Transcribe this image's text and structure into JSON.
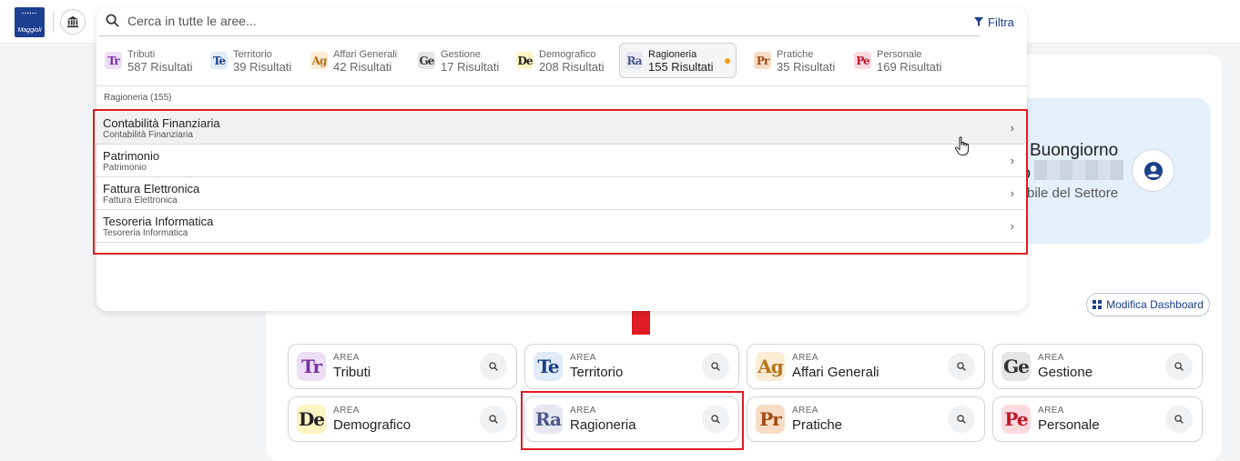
{
  "header": {
    "logo_text": "Maggioli"
  },
  "greeting": {
    "title": "Buongiorno",
    "prefix": "o",
    "role": "bile del Settore"
  },
  "dashboard": {
    "edit_label": "Modifica Dashboard",
    "area_caption": "AREA",
    "areas": [
      {
        "abbr": "Tr",
        "name": "Tributi",
        "color": "#7b2fa6",
        "bg": "#ecdff5"
      },
      {
        "abbr": "Te",
        "name": "Territorio",
        "color": "#1c3f88",
        "bg": "#e1ecf8"
      },
      {
        "abbr": "Ag",
        "name": "Affari Generali",
        "color": "#b8741a",
        "bg": "#fbecd6"
      },
      {
        "abbr": "Ge",
        "name": "Gestione",
        "color": "#333333",
        "bg": "#e5e5e5"
      },
      {
        "abbr": "De",
        "name": "Demografico",
        "color": "#222222",
        "bg": "#fdf4c4"
      },
      {
        "abbr": "Ra",
        "name": "Ragioneria",
        "color": "#4b5689",
        "bg": "#e6e8f1"
      },
      {
        "abbr": "Pr",
        "name": "Pratiche",
        "color": "#a34a15",
        "bg": "#f7dcc6"
      },
      {
        "abbr": "Pe",
        "name": "Personale",
        "color": "#c0162a",
        "bg": "#fadadf"
      }
    ]
  },
  "search": {
    "placeholder": "Cerca in tutte le aree...",
    "filter_label": "Filtra",
    "chips": [
      {
        "abbr": "Tr",
        "name": "Tributi",
        "count": "587 Risultati",
        "color": "#7b2fa6",
        "bg": "#ecdff5"
      },
      {
        "abbr": "Te",
        "name": "Territorio",
        "count": "39 Risultati",
        "color": "#1c3f88",
        "bg": "#e1ecf8"
      },
      {
        "abbr": "Ag",
        "name": "Affari Generali",
        "count": "42 Risultati",
        "color": "#b8741a",
        "bg": "#fbecd6"
      },
      {
        "abbr": "Ge",
        "name": "Gestione",
        "count": "17 Risultati",
        "color": "#333333",
        "bg": "#e5e5e5"
      },
      {
        "abbr": "De",
        "name": "Demografico",
        "count": "208 Risultati",
        "color": "#222222",
        "bg": "#fdf4c4"
      },
      {
        "abbr": "Ra",
        "name": "Ragioneria",
        "count": "155 Risultati",
        "color": "#4b5689",
        "bg": "#e6e8f1"
      },
      {
        "abbr": "Pr",
        "name": "Pratiche",
        "count": "35 Risultati",
        "color": "#a34a15",
        "bg": "#f7dcc6"
      },
      {
        "abbr": "Pe",
        "name": "Personale",
        "count": "169 Risultati",
        "color": "#c0162a",
        "bg": "#fadadf"
      }
    ],
    "section_label": "Ragioneria (155)",
    "results": [
      {
        "title": "Contabilità Finanziaria",
        "subtitle": "Contabilità Finanziaria"
      },
      {
        "title": "Patrimonio",
        "subtitle": "Patrimonio"
      },
      {
        "title": "Fattura Elettronica",
        "subtitle": "Fattura Elettronica"
      },
      {
        "title": "Tesoreria Informatica",
        "subtitle": "Tesoreria Informatica"
      }
    ]
  },
  "annotations": {
    "highlight_color": "#e01b24",
    "arrow_color": "#e01b24"
  }
}
